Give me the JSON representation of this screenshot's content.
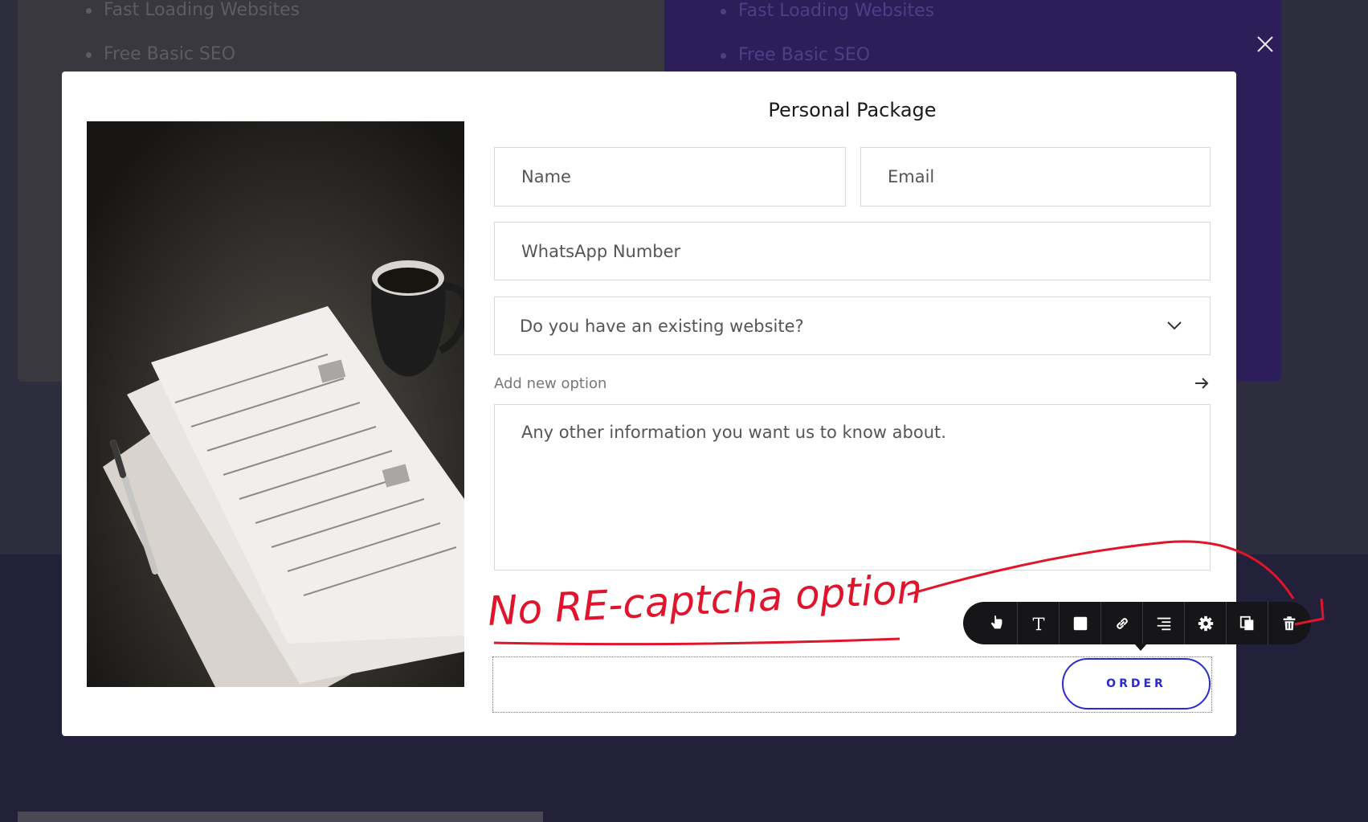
{
  "background": {
    "left_list": [
      "Fast Loading Websites",
      "Free Basic SEO"
    ],
    "right_list": [
      "Fast Loading Websites",
      "Free Basic SEO"
    ]
  },
  "modal": {
    "title": "Personal Package",
    "fields": {
      "name_placeholder": "Name",
      "email_placeholder": "Email",
      "whatsapp_placeholder": "WhatsApp Number",
      "website_select_value": "Do you have an existing website?",
      "add_option_label": "Add new option",
      "message_placeholder": "Any other information you want us to know about."
    },
    "order_label": "ORDER"
  },
  "toolbar": {
    "tools": [
      "hand-pointer-icon",
      "text-icon",
      "fill-square-icon",
      "link-icon",
      "align-right-icon",
      "gear-icon",
      "duplicate-icon",
      "trash-icon"
    ]
  },
  "annotation": {
    "text": "No RE-captcha option",
    "color": "#e0142a"
  },
  "colors": {
    "accent": "#2a2ad4",
    "overlay": "#2e2d3d",
    "toolbar": "#161619"
  }
}
